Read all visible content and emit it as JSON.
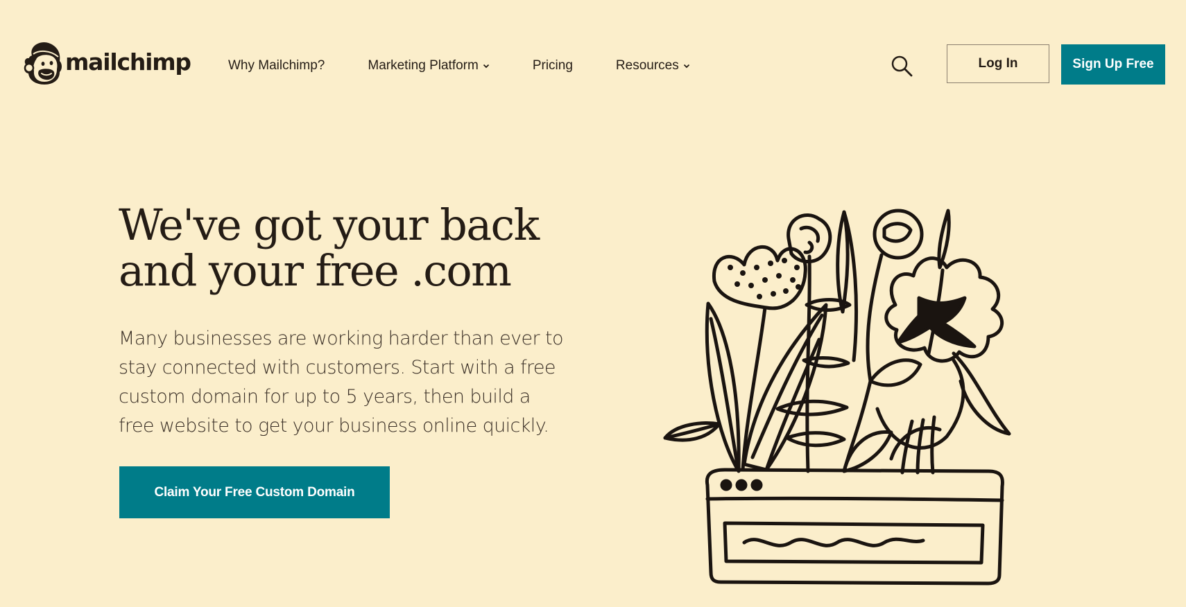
{
  "brand": {
    "name": "mailchimp",
    "colors": {
      "background": "#fbeecb",
      "text": "#241c15",
      "accent": "#007c89"
    }
  },
  "nav": {
    "items": [
      {
        "label": "Why Mailchimp?",
        "has_dropdown": false
      },
      {
        "label": "Marketing Platform",
        "has_dropdown": true
      },
      {
        "label": "Pricing",
        "has_dropdown": false
      },
      {
        "label": "Resources",
        "has_dropdown": true
      }
    ],
    "search_icon": "search-icon",
    "login_label": "Log In",
    "signup_label": "Sign Up Free"
  },
  "hero": {
    "title_lines": [
      "We've got your back",
      "and your free .com"
    ],
    "body_lines": [
      "Many businesses are working harder than ever to",
      "stay connected with customers. Start with a free",
      "custom domain for up to 5 years, then build a",
      "free website to get your business online quickly."
    ],
    "cta_label": "Claim Your Free Custom Domain",
    "illustration": "flower-pot-illustration"
  }
}
